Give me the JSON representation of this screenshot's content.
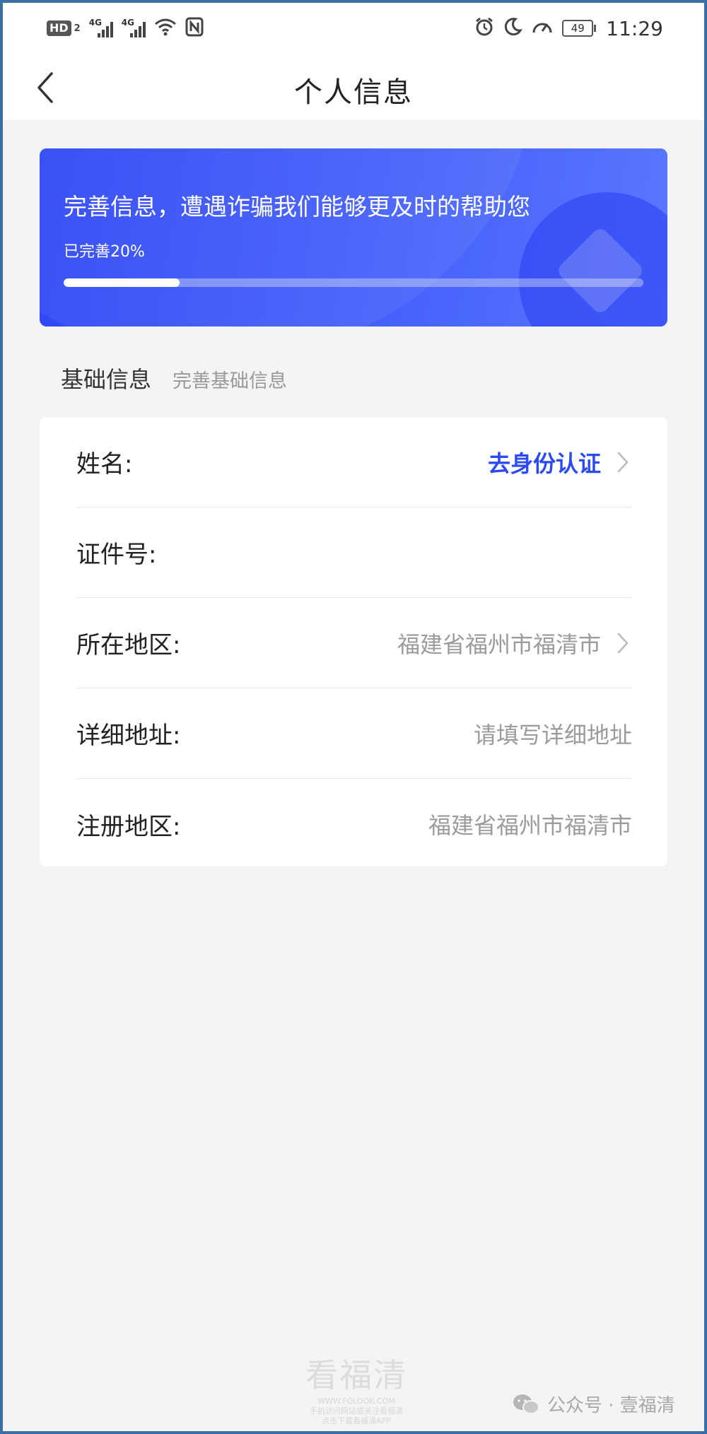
{
  "status_bar": {
    "left": {
      "hd": "HD",
      "sim": "2",
      "net1": "4G",
      "net2": "4G"
    },
    "battery": "49",
    "time": "11:29"
  },
  "nav": {
    "title": "个人信息"
  },
  "banner": {
    "title": "完善信息，遭遇诈骗我们能够更及时的帮助您",
    "progress_text": "已完善20%",
    "progress_fraction": 0.2
  },
  "section": {
    "title": "基础信息",
    "subtitle": "完善基础信息"
  },
  "rows": [
    {
      "label": "姓名:",
      "value": "去身份认证"
    },
    {
      "label": "证件号:",
      "value": ""
    },
    {
      "label": "所在地区:",
      "value": "福建省福州市福清市"
    },
    {
      "label": "详细地址:",
      "placeholder": "请填写详细地址"
    },
    {
      "label": "注册地区:",
      "value": "福建省福州市福清市"
    }
  ],
  "watermark": {
    "center_big": "看福清",
    "center_url": "WWW.FQLOOK.COM",
    "center_line1": "手机访问网站或关注看福清",
    "center_line2": "点击下载看福清APP",
    "right": "公众号 · 壹福清"
  },
  "colors": {
    "accent": "#2b4af2",
    "banner_start": "#2e47f5",
    "banner_end": "#5a78ff"
  }
}
